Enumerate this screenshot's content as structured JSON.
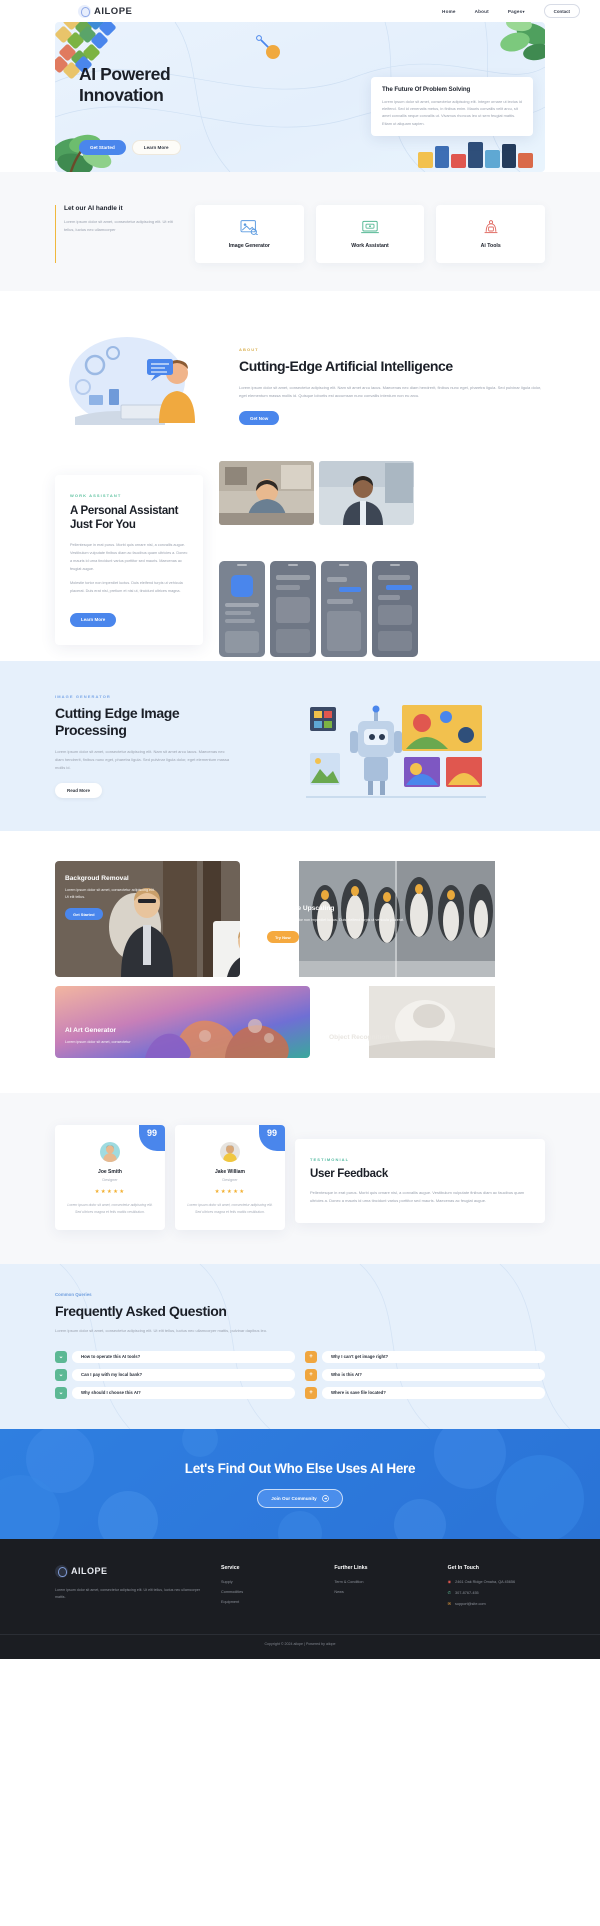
{
  "brand": {
    "name": "AILOPE"
  },
  "nav": {
    "items": [
      {
        "label": "Home"
      },
      {
        "label": "About"
      },
      {
        "label": "Pages",
        "caret": "▾"
      }
    ],
    "cta": "Contact"
  },
  "hero": {
    "title_line1": "AI Powered",
    "title_line2": "Innovation",
    "primary_btn": "Get Started",
    "secondary_btn": "Learn More",
    "card_title": "The Future Of Problem Solving",
    "card_text": "Lorem ipsum dolor sit amet, consectetur adipiscing elit. Integer ornare ut lectus id eleifend. Sed id venenatis metus, in finibus enim. Mauris convallis velit arcu, sit amet convallis neque convallis ut. Vivamus rhoncus leo ut sem feugiat mattis. Etiam ut aliquam sapien."
  },
  "features": {
    "intro_title": "Let our AI handle it",
    "intro_text": "Lorem ipsum dolor sit amet, consectetur adipiscing elit. Ut elit tellus, luctus nec ullamcorper",
    "cards": [
      {
        "label": "Image Generator",
        "icon": "image-generator-icon"
      },
      {
        "label": "Work Assistant",
        "icon": "work-assistant-icon"
      },
      {
        "label": "Ai Tools",
        "icon": "ai-tools-icon"
      }
    ]
  },
  "about": {
    "eyebrow": "ABOUT",
    "title": "Cutting-Edge Artificial Intelligence",
    "text": "Lorem ipsum dolor sit amet, consectetur adipiscing elit. Nam sit amet arcu lacus. Maecenas nec diam hendrerit, finibus nunc eget, pharetra ligula. Sed pulvinar ligula dolor, eget elementum massa mollis id. Quisque lobortis est accumsan nunc convallis interdum non eu arcu.",
    "btn": "Get Now"
  },
  "assistant": {
    "eyebrow": "WORK ASSISTANT",
    "title": "A Personal Assistant Just For You",
    "text1": "Pellentesque in erat purus. Morbi quis ornare nisl, a convallis augue. Vestibulum vulputate finibus diam ac faucibus quam ultricies a. Donec a mauris id urna tincidunt varius porttitor sed mauris. Maecenas ac feugiat augue.",
    "text2": "Molestie tortor non imperdiet luctus. Duis eleifend turpis ut vehicula placerat. Duis erat nisi, pretium et nisi ut, tincidunt ultrices magna.",
    "btn": "Learn More"
  },
  "image_processing": {
    "eyebrow": "IMAGE GENERATOR",
    "title": "Cutting Edge Image Processing",
    "text": "Lorem ipsum dolor sit amet, consectetur adipiscing elit. Nam sit amet arcu lacus. Maecenas nec diam hendrerit, finibus nunc eget, pharetra ligula. Sed pulvinar ligula dolor, eget elementum massa mollis id.",
    "btn": "Read More"
  },
  "gallery": {
    "cards": [
      {
        "title": "Backgroud Removal",
        "desc": "Lorem ipsum dolor sit amet, consectetur adipiscing elit. Ut elit tellus.",
        "btn": "Get Started",
        "btn_style": "blue"
      },
      {
        "title": "Generative Upscaling",
        "desc": "Integer molestie tortor non imperdiet luctus. Duis eleifend turpis ut vehicula placerat.",
        "btn": "Try Now",
        "btn_style": "orange"
      },
      {
        "title": "AI Art Generator",
        "desc": "Lorem ipsum dolor sit amet, consectetur",
        "btn": "",
        "btn_style": "none"
      },
      {
        "title": "Object Recognition",
        "desc": "",
        "btn": "",
        "btn_style": "none"
      }
    ]
  },
  "testimonials": {
    "eyebrow": "TESTIMONIAL",
    "heading": "User Feedback",
    "heading_text": "Pellentesque in erat purus. Morbi quis ornare nisl, a convallis augue. Vestibulum vulputate finibus diam ac faucibus quam ultricies a. Donec a mauris id urna tincidunt varius porttitor sed mauris. Maecenas ac feugiat augue.",
    "quote_glyph": "99",
    "cards": [
      {
        "name": "Joe Smith",
        "role": "Designer",
        "stars": "★★★★★",
        "text": "Lorem ipsum dolor sit amet, consectetur adipiscing elit. Sed ultrices magna et felis mattis vestibulum."
      },
      {
        "name": "Jake William",
        "role": "Designer",
        "stars": "★★★★★",
        "text": "Lorem ipsum dolor sit amet, consectetur adipiscing elit. Sed ultrices magna et felis mattis vestibulum."
      }
    ]
  },
  "faq": {
    "eyebrow": "Common Queries",
    "title": "Frequently Asked Question",
    "text": "Lorem ipsum dolor sit amet, consectetur adipiscing elit. Ut elit tellus, luctus nec ullamcorper mattis, pulvinar dapibus leo.",
    "left": [
      {
        "icon": "chevron-down-icon",
        "q": "How to operate this AI tools?"
      },
      {
        "icon": "chevron-down-icon",
        "q": "Can I pay with my local bank?"
      },
      {
        "icon": "chevron-down-icon",
        "q": "Why should I choose this AI?"
      }
    ],
    "right": [
      {
        "icon": "plus-icon",
        "q": "Why I can't get image right?"
      },
      {
        "icon": "plus-icon",
        "q": "Who is this AI?"
      },
      {
        "icon": "plus-icon",
        "q": "Where is save file located?"
      }
    ]
  },
  "cta": {
    "title": "Let's Find Out Who Else Uses AI Here",
    "btn": "Join Our Community",
    "btn_icon": "arrow-right-circle-icon"
  },
  "footer": {
    "brand": "AILOPE",
    "about": "Lorem ipsum dolor sit amet, consectetur adipiscing elit. Ut elit tellus, luctus nec ullamcorper mattis.",
    "cols": [
      {
        "title": "Service",
        "links": [
          "Supply",
          "Commodities",
          "Equipment"
        ]
      },
      {
        "title": "Further Links",
        "links": [
          "Term & Condition",
          "News"
        ]
      }
    ],
    "contact_title": "Get In Touch",
    "contacts": [
      {
        "icon": "location-icon",
        "text": "2461 Oak Ridge Omaha, QA 45656"
      },
      {
        "icon": "phone-icon",
        "text": "307-8767-455"
      },
      {
        "icon": "mail-icon",
        "text": "support@site.com"
      }
    ],
    "copyright": "Copyright © 2024 ailope | Powered by ailope"
  },
  "colors": {
    "accent_blue": "#4a86ec",
    "accent_orange": "#f5a93f",
    "accent_green": "#5cb894",
    "hero_bg": "#e6f0fb",
    "footer_bg": "#1b1d22"
  }
}
